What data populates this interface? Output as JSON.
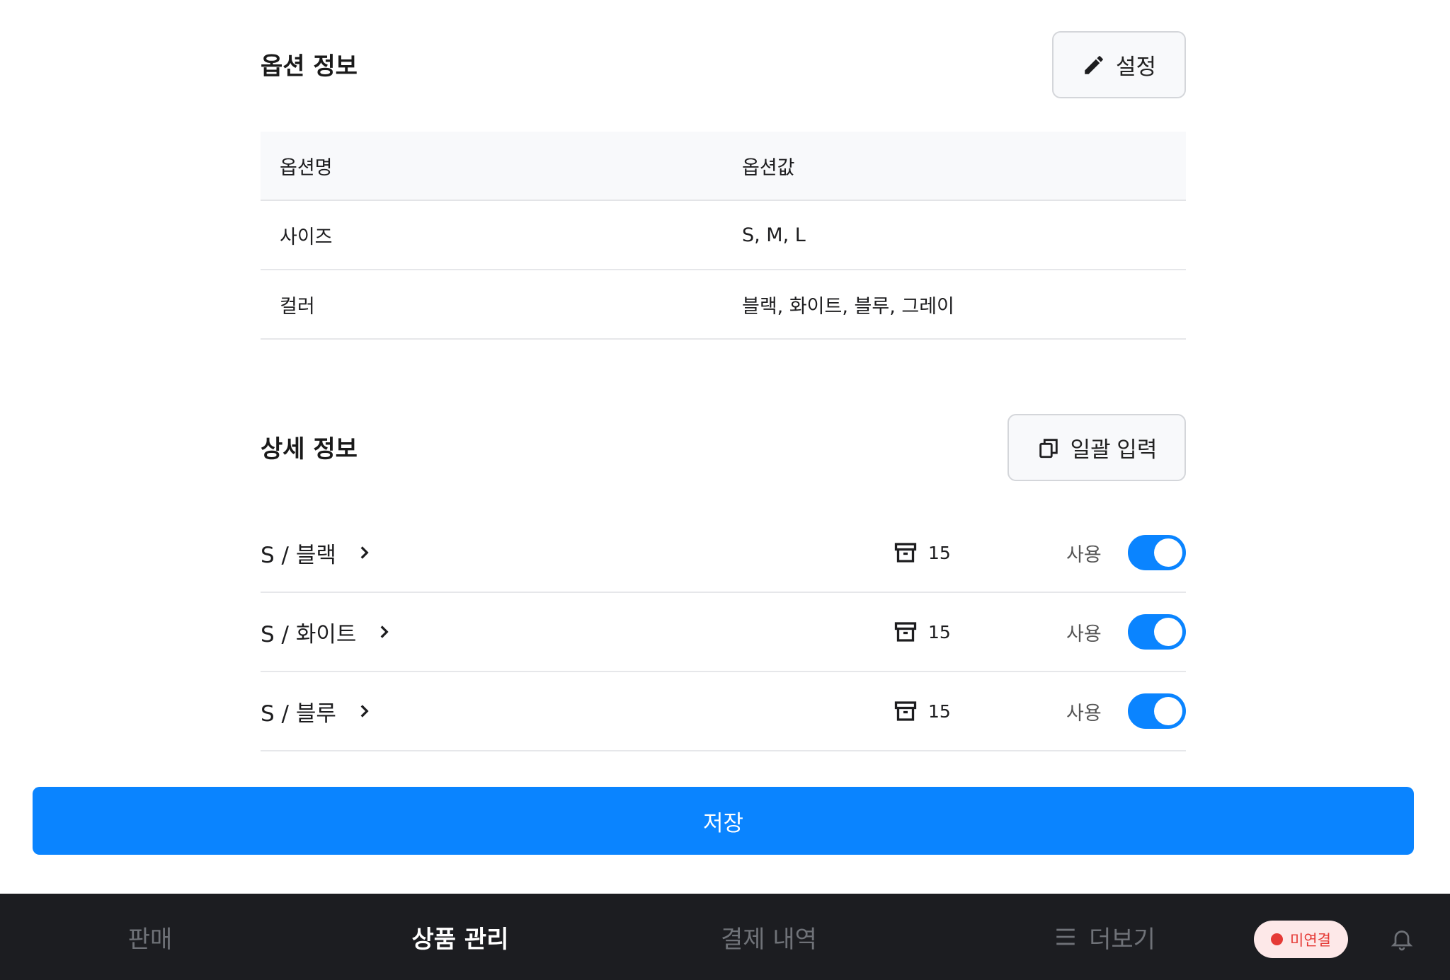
{
  "options": {
    "title": "옵션 정보",
    "edit_label": "설정",
    "columns": [
      "옵션명",
      "옵션값"
    ],
    "rows": [
      {
        "name": "사이즈",
        "value": "S, M, L"
      },
      {
        "name": "컬러",
        "value": "블랙, 화이트, 블루, 그레이"
      }
    ]
  },
  "details": {
    "title": "상세 정보",
    "bulk_label": "일괄 입력",
    "rows": [
      {
        "variant": "S / 블랙",
        "stock": "15",
        "use_label": "사용",
        "enabled": true
      },
      {
        "variant": "S / 화이트",
        "stock": "15",
        "use_label": "사용",
        "enabled": true
      },
      {
        "variant": "S / 블루",
        "stock": "15",
        "use_label": "사용",
        "enabled": true
      }
    ]
  },
  "save_label": "저장",
  "nav": {
    "items": [
      "판매",
      "상품 관리",
      "결제 내역",
      "더보기"
    ],
    "active_index": 1,
    "status": "미연결"
  },
  "colors": {
    "primary": "#0a84ff",
    "nav_bg": "#1c1d21",
    "status_red": "#e53935"
  }
}
